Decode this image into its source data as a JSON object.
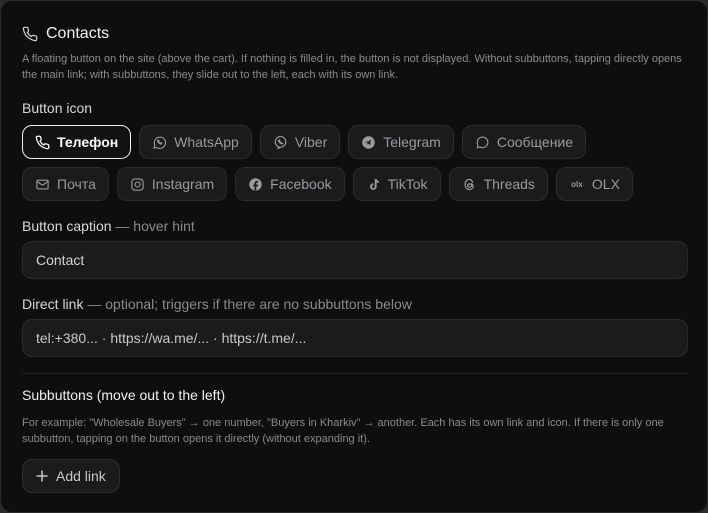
{
  "panel": {
    "title": "Contacts",
    "description": "A floating button on the site (above the cart). If nothing is filled in, the button is not displayed. Without subbuttons, tapping directly opens the main link; with subbuttons, they slide out to the left, each with its own link."
  },
  "icon_section": {
    "label": "Button icon",
    "chips": [
      {
        "label": "Телефон",
        "icon": "phone-icon",
        "selected": true
      },
      {
        "label": "WhatsApp",
        "icon": "whatsapp-icon"
      },
      {
        "label": "Viber",
        "icon": "viber-icon"
      },
      {
        "label": "Telegram",
        "icon": "telegram-icon"
      },
      {
        "label": "Сообщение",
        "icon": "message-icon"
      },
      {
        "label": "Почта",
        "icon": "mail-icon"
      },
      {
        "label": "Instagram",
        "icon": "instagram-icon"
      },
      {
        "label": "Facebook",
        "icon": "facebook-icon"
      },
      {
        "label": "TikTok",
        "icon": "tiktok-icon"
      },
      {
        "label": "Threads",
        "icon": "threads-icon"
      },
      {
        "label": "OLX",
        "icon": "olx-icon",
        "icon_text": "olx"
      }
    ]
  },
  "caption_section": {
    "label": "Button caption",
    "hint": "— hover hint",
    "value": "Contact"
  },
  "link_section": {
    "label": "Direct link",
    "hint": "— optional; triggers if there are no subbuttons below",
    "value": "tel:+380... · https://wa.me/... · https://t.me/..."
  },
  "subbuttons": {
    "title": "Subbuttons (move out to the left)",
    "description": "For example: \"Wholesale Buyers\" → one number, \"Buyers in Kharkiv\" → another. Each has its own link and icon. If there is only one subbutton, tapping on the button opens it directly (without expanding it).",
    "add_label": "Add link"
  }
}
